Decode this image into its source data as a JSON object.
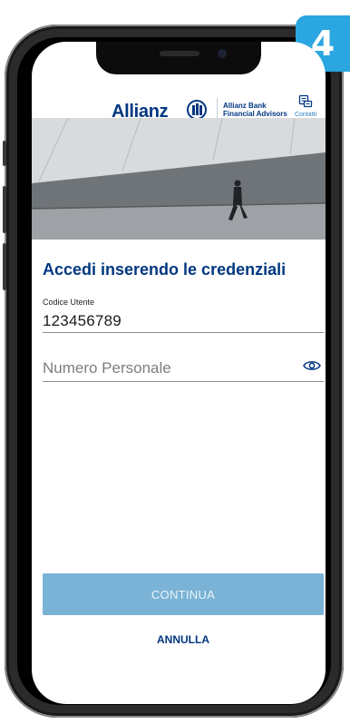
{
  "step_badge": "4",
  "header": {
    "logo_brand": "Allianz",
    "logo_subtitle_1": "Allianz Bank",
    "logo_subtitle_2": "Financial Advisors",
    "contacts_label": "Contatti",
    "contacts_icon": "chat-icon"
  },
  "form": {
    "title": "Accedi inserendo le credenziali",
    "user_code_label": "Codice Utente",
    "user_code_value": "123456789",
    "personal_number_placeholder": "Numero Personale",
    "toggle_icon": "eye-icon"
  },
  "actions": {
    "continue_label": "CONTINUA",
    "cancel_label": "ANNULLA"
  },
  "colors": {
    "brand": "#003781",
    "badge": "#2aa6e0",
    "button_disabled": "#7ab3d5"
  }
}
